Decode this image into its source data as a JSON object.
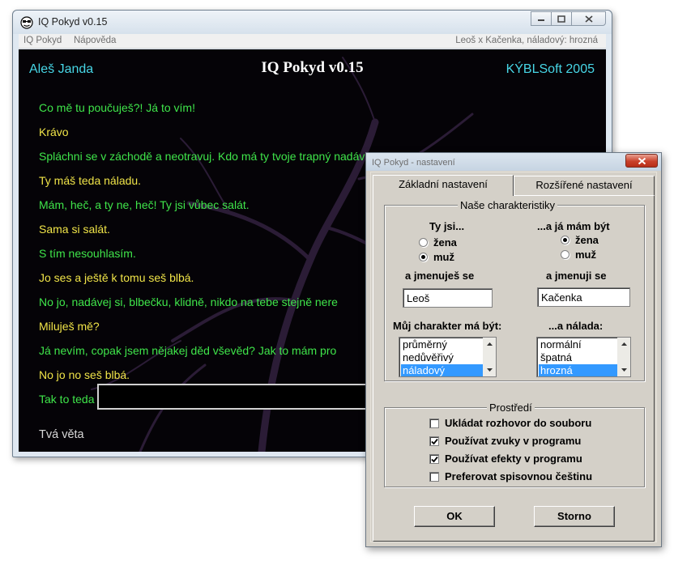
{
  "main_window": {
    "title": "IQ Pokyd v0.15",
    "menu": [
      "IQ Pokyd",
      "Nápověda"
    ],
    "status": "Leoš x Kačenka, náladový: hrozná",
    "header": {
      "left": "Aleš Janda",
      "center": "IQ Pokyd v0.15",
      "right": "KÝBLSoft 2005"
    },
    "messages": [
      {
        "text": "Co mě tu poučuješ?! Já to vím!",
        "color": "green"
      },
      {
        "text": "Krávo",
        "color": "yellow"
      },
      {
        "text": "Spláchni se v záchodě a neotravuj. Kdo má ty tvoje trapný nadávky poslouchat?",
        "color": "green"
      },
      {
        "text": "Ty máš teda náladu.",
        "color": "yellow"
      },
      {
        "text": "Mám, heč, a ty ne, heč! Ty jsi vůbec salát.",
        "color": "green"
      },
      {
        "text": "Sama si salát.",
        "color": "yellow"
      },
      {
        "text": "S tím nesouhlasím.",
        "color": "green"
      },
      {
        "text": "Jo ses a ještě k tomu seš blbá.",
        "color": "yellow"
      },
      {
        "text": "No jo, nadávej si, blbečku, klidně, nikdo na tebe stejně nere",
        "color": "green"
      },
      {
        "text": "Miluješ mě?",
        "color": "yellow"
      },
      {
        "text": "Já nevím, copak jsem nějakej děd vševěd? Jak to mám pro",
        "color": "green"
      },
      {
        "text": "No jo no seš blbá.",
        "color": "yellow"
      },
      {
        "text": "Tak to teda ani náhodou! To je pěkná blbost.",
        "color": "green"
      }
    ],
    "input_label": "Tvá věta",
    "input_value": ""
  },
  "settings": {
    "title": "IQ Pokyd - nastavení",
    "tabs": [
      "Základní nastavení",
      "Rozšířené nastavení"
    ],
    "characteristics": {
      "legend": "Naše charakteristiky",
      "you_are_label": "Ty jsi...",
      "i_am_label": "...a já mám být",
      "you_options": [
        "žena",
        "muž"
      ],
      "you_selected": "muž",
      "me_options": [
        "žena",
        "muž"
      ],
      "me_selected": "žena",
      "your_name_label": "a jmenuješ se",
      "your_name": "Leoš",
      "my_name_label": "a jmenuji se",
      "my_name": "Kačenka",
      "character_label": "Můj charakter má být:",
      "character_options": [
        "průměrný",
        "nedůvěřivý",
        "náladový"
      ],
      "character_selected": "náladový",
      "mood_label": "...a nálada:",
      "mood_options": [
        "normální",
        "špatná",
        "hrozná"
      ],
      "mood_selected": "hrozná"
    },
    "environment": {
      "legend": "Prostředí",
      "options": [
        {
          "label": "Ukládat rozhovor do souboru",
          "checked": false
        },
        {
          "label": "Používat zvuky v programu",
          "checked": true
        },
        {
          "label": "Používat efekty v programu",
          "checked": true
        },
        {
          "label": "Preferovat spisovnou češtinu",
          "checked": false
        }
      ]
    },
    "ok_label": "OK",
    "cancel_label": "Storno"
  },
  "colors": {
    "msg_green": "#3fe54a",
    "msg_yellow": "#f0e448",
    "header_cyan": "#47d6e6",
    "selection": "#3399ff"
  }
}
